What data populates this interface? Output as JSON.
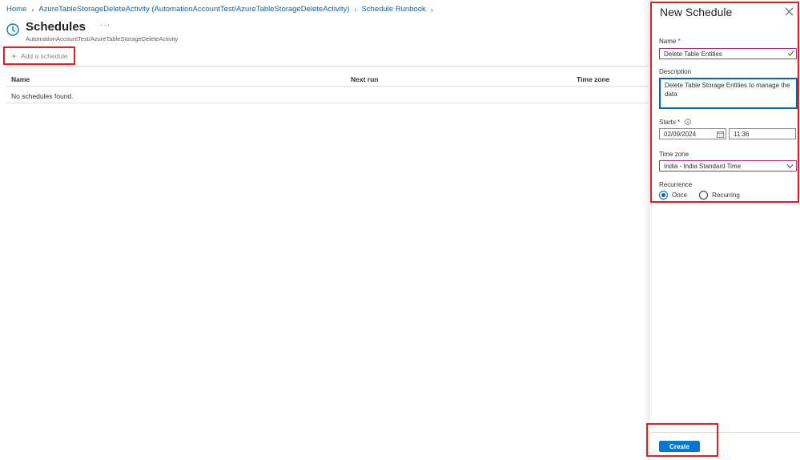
{
  "breadcrumb": {
    "items": [
      "Home",
      "AzureTableStorageDeleteActivity (AutomationAccountTest/AzureTableStorageDeleteActivity)",
      "Schedule Runbook"
    ]
  },
  "header": {
    "title": "Schedules",
    "more": "···",
    "subtitle": "AutomationAccountTest/AzureTableStorageDeleteActivity",
    "icon": "clock-icon"
  },
  "toolbar": {
    "add_label": "Add a schedule"
  },
  "table": {
    "columns": [
      "Name",
      "Next run",
      "Time zone"
    ],
    "empty_message": "No schedules found."
  },
  "panel": {
    "title": "New Schedule",
    "name": {
      "label": "Name",
      "required": "*",
      "value": "Delete Table Entities"
    },
    "description": {
      "label": "Description",
      "value": "Delete Table Storage Entities to manage the data"
    },
    "starts": {
      "label": "Starts",
      "required": "*",
      "date": "02/09/2024",
      "time": "11:36"
    },
    "timezone": {
      "label": "Time zone",
      "value": "India - India Standard Time"
    },
    "recurrence": {
      "label": "Recurrence",
      "options": [
        "Once",
        "Recurring"
      ],
      "selected": "Once"
    },
    "create_label": "Create"
  },
  "colors": {
    "accent": "#0078d4",
    "link": "#0066b8",
    "highlight": "#e02020"
  }
}
